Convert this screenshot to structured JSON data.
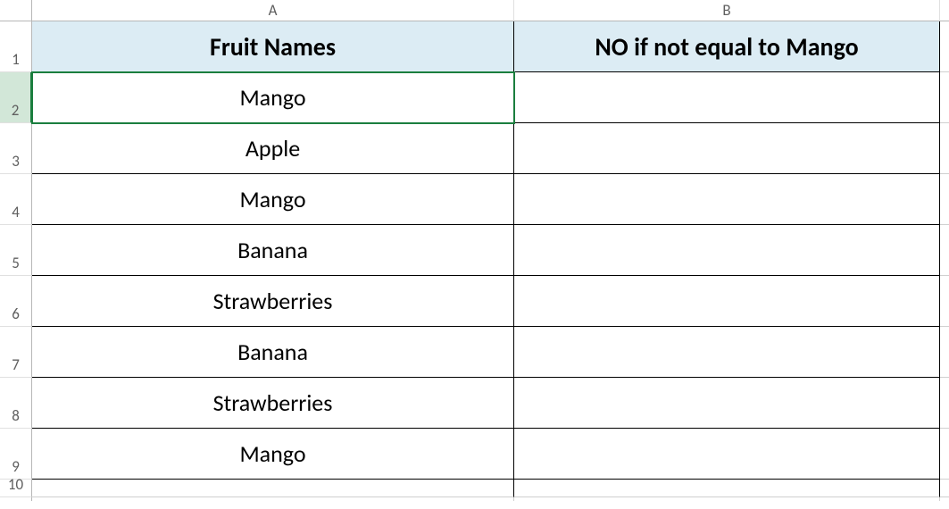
{
  "columns": {
    "A": "A",
    "B": "B"
  },
  "rows": [
    "1",
    "2",
    "3",
    "4",
    "5",
    "6",
    "7",
    "8",
    "9",
    "10"
  ],
  "headers": {
    "A": "Fruit Names",
    "B": "NO if not equal to Mango"
  },
  "data": {
    "A": [
      "Mango",
      "Apple",
      "Mango",
      "Banana",
      "Strawberries",
      "Banana",
      "Strawberries",
      "Mango",
      ""
    ],
    "B": [
      "",
      "",
      "",
      "",
      "",
      "",
      "",
      "",
      ""
    ]
  },
  "activeCell": "A2",
  "chart_data": {
    "type": "table",
    "columns": [
      "Fruit Names",
      "NO if not equal to Mango"
    ],
    "rows": [
      [
        "Mango",
        ""
      ],
      [
        "Apple",
        ""
      ],
      [
        "Mango",
        ""
      ],
      [
        "Banana",
        ""
      ],
      [
        "Strawberries",
        ""
      ],
      [
        "Banana",
        ""
      ],
      [
        "Strawberries",
        ""
      ],
      [
        "Mango",
        ""
      ]
    ]
  }
}
